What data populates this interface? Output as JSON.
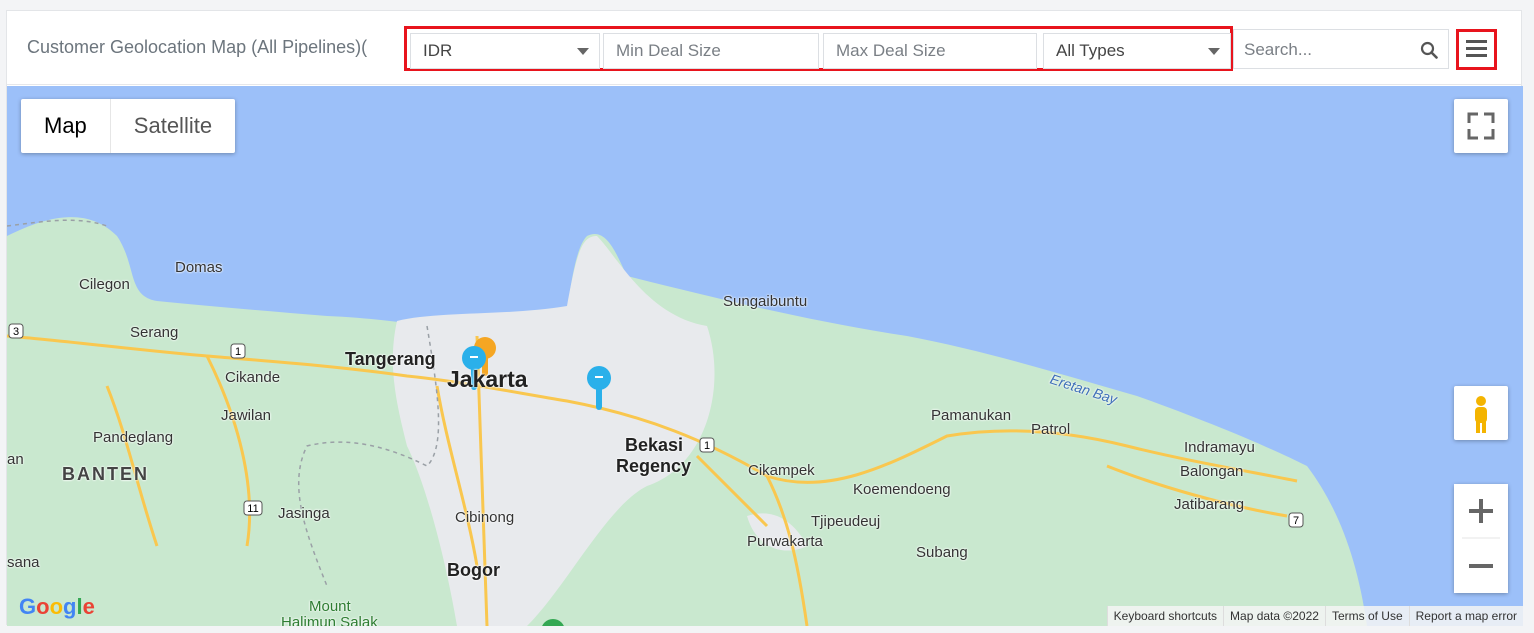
{
  "header": {
    "title": "Customer Geolocation Map (All Pipelines)(",
    "currency": "IDR",
    "min_deal_placeholder": "Min Deal Size",
    "max_deal_placeholder": "Max Deal Size",
    "type_select": "All Types",
    "search_placeholder": "Search..."
  },
  "map": {
    "map_type_map": "Map",
    "map_type_satellite": "Satellite",
    "labels": {
      "domas": "Domas",
      "cilegon": "Cilegon",
      "serang": "Serang",
      "tangerang": "Tangerang",
      "jakarta": "Jakarta",
      "cikande": "Cikande",
      "jawilan": "Jawilan",
      "pandeglang": "Pandeglang",
      "banten": "BANTEN",
      "jasinga": "Jasinga",
      "cibinong": "Cibinong",
      "bogor": "Bogor",
      "mount": "Mount",
      "halimun": "Halimun Salak",
      "sungaibuntu": "Sungaibuntu",
      "bekasi": "Bekasi",
      "regency": "Regency",
      "cikampek": "Cikampek",
      "koemendoeng": "Koemendoeng",
      "tjipeudeuj": "Tjipeudeuj",
      "purwakarta": "Purwakarta",
      "subang": "Subang",
      "pamanukan": "Pamanukan",
      "patrol": "Patrol",
      "eretan": "Eretan Bay",
      "indramayu": "Indramayu",
      "balongan": "Balongan",
      "jatibarang": "Jatibarang",
      "an": "an",
      "sana": "sana"
    },
    "shields": [
      "3",
      "1",
      "11",
      "1",
      "7"
    ],
    "footer": {
      "shortcuts": "Keyboard shortcuts",
      "mapdata": "Map data ©2022",
      "terms": "Terms of Use",
      "report": "Report a map error"
    },
    "google_logo": "Google",
    "colors": {
      "water": "#9cc0f9",
      "land": "#c9e8cf",
      "urban": "#e8eaed",
      "road": "#f9c74f",
      "pin_blue": "#2ab0ea",
      "pin_orange": "#f5a623"
    }
  }
}
